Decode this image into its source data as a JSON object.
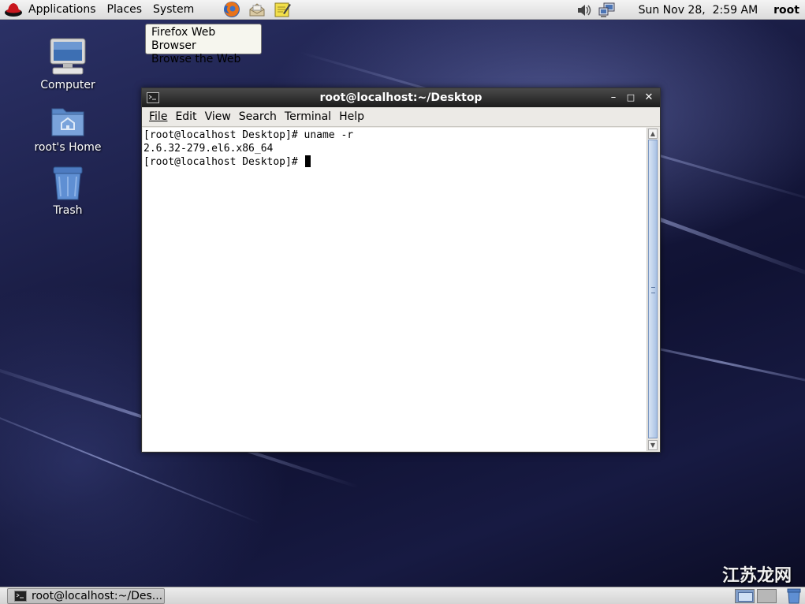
{
  "top_panel": {
    "menus": [
      "Applications",
      "Places",
      "System"
    ],
    "launchers": [
      "firefox-icon",
      "mail-icon",
      "notes-icon"
    ],
    "clock": "Sun Nov 28,  2:59 AM",
    "user": "root"
  },
  "tooltip": {
    "line1": "Firefox Web Browser",
    "line2": "Browse the Web"
  },
  "desktop_icons": [
    {
      "label": "Computer",
      "icon": "computer-icon"
    },
    {
      "label": "root's Home",
      "icon": "home-folder-icon"
    },
    {
      "label": "Trash",
      "icon": "trash-icon"
    }
  ],
  "terminal": {
    "title": "root@localhost:~/Desktop",
    "menu": [
      "File",
      "Edit",
      "View",
      "Search",
      "Terminal",
      "Help"
    ],
    "lines": [
      "[root@localhost Desktop]# uname -r",
      "2.6.32-279.el6.x86_64",
      "[root@localhost Desktop]# "
    ]
  },
  "taskbar": {
    "window_label": "root@localhost:~/Des..."
  },
  "watermark": "江苏龙网"
}
